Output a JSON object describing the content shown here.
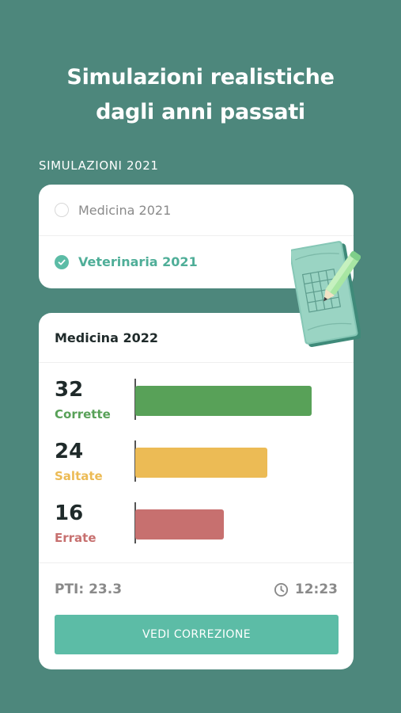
{
  "headline": {
    "line1": "Simulazioni realistiche",
    "line2": "dagli anni passati"
  },
  "section_label": "SIMULAZIONI 2021",
  "options": [
    {
      "label": "Medicina 2021",
      "selected": false
    },
    {
      "label": "Veterinaria 2021",
      "selected": true
    }
  ],
  "results": {
    "title": "Medicina 2022",
    "stats": [
      {
        "value": "32",
        "label": "Corrette",
        "color": "#58a158",
        "amount": 32
      },
      {
        "value": "24",
        "label": "Saltate",
        "color": "#ecbb55",
        "amount": 24
      },
      {
        "value": "16",
        "label": "Errate",
        "color": "#c7706f",
        "amount": 16
      }
    ],
    "pti": "PTI: 23.3",
    "time": "12:23",
    "button_label": "VEDI CORREZIONE"
  },
  "colors": {
    "background": "#4d877c",
    "accent": "#5cbca6"
  },
  "icons": {
    "selected": "check-circle-icon",
    "timer": "clock-icon",
    "illustration": "notebook-pencil-icon"
  }
}
